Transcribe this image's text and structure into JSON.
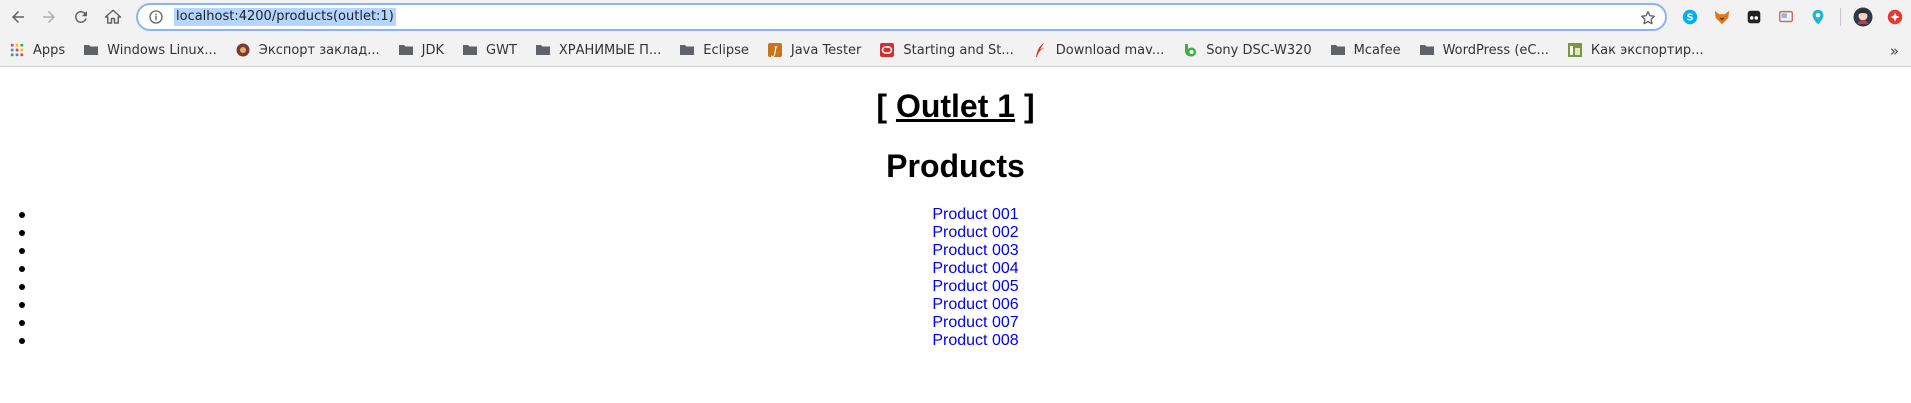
{
  "browser": {
    "url": "localhost:4200/products(outlet:1)",
    "icons": [
      "back-icon",
      "forward-icon",
      "reload-icon",
      "home-icon",
      "info-icon",
      "star-icon"
    ],
    "extensions": [
      "skype-icon",
      "fox-icon",
      "glasses-icon",
      "cast-icon",
      "pin-icon",
      "profile-avatar-icon",
      "extension-icon"
    ]
  },
  "bookmarks": [
    {
      "label": "Apps",
      "icon": "apps-grid-icon"
    },
    {
      "label": "Windows Linux...",
      "icon": "folder-icon"
    },
    {
      "label": "Экспорт заклад...",
      "icon": "bookmark-site-icon"
    },
    {
      "label": "JDK",
      "icon": "folder-icon"
    },
    {
      "label": "GWT",
      "icon": "folder-icon"
    },
    {
      "label": "ХРАНИМЫЕ П...",
      "icon": "folder-icon"
    },
    {
      "label": "Eclipse",
      "icon": "folder-icon"
    },
    {
      "label": "Java Tester",
      "icon": "java-icon"
    },
    {
      "label": "Starting and St...",
      "icon": "oracle-icon"
    },
    {
      "label": "Download mav...",
      "icon": "feather-icon"
    },
    {
      "label": "Sony DSC-W320",
      "icon": "sony-icon"
    },
    {
      "label": "Mcafee",
      "icon": "folder-icon"
    },
    {
      "label": "WordPress (eC...",
      "icon": "folder-icon"
    },
    {
      "label": "Как экспортир...",
      "icon": "site-icon"
    }
  ],
  "bookmarks_more": "»",
  "page": {
    "outlet_prefix": "[",
    "outlet_link": "Outlet 1",
    "outlet_suffix": "]",
    "heading": "Products",
    "products": [
      "Product 001",
      "Product 002",
      "Product 003",
      "Product 004",
      "Product 005",
      "Product 006",
      "Product 007",
      "Product 008"
    ]
  },
  "colors": {
    "link": "#0000ee",
    "url_selection": "#b4d5fe",
    "omnibox_border": "#8ab4f8"
  }
}
